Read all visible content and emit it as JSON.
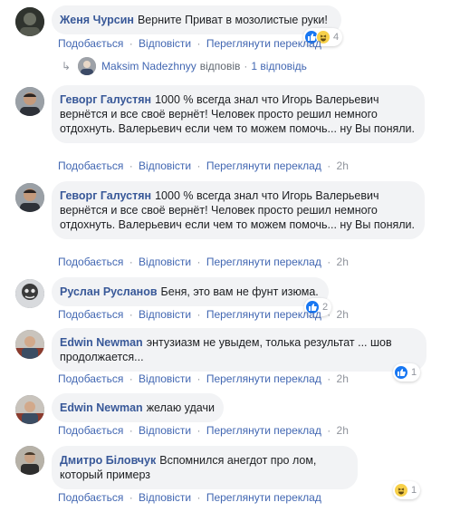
{
  "actions": {
    "like": "Подобається",
    "reply": "Відповісти",
    "translate": "Переглянути переклад",
    "sep": "·"
  },
  "comments": [
    {
      "author": "Женя Чурсин",
      "text": "Верните Приват в мозолистые руки!",
      "time": "",
      "reactions": {
        "types": [
          "like",
          "haha"
        ],
        "count": "4"
      },
      "replies": {
        "author": "Maksim Nadezhnyy",
        "verb": "відповів",
        "sep": "·",
        "count": "1 відповідь"
      }
    },
    {
      "author": "Геворг Галустян",
      "text": "1000 % всегда знал что Игорь Валерьевич вернётся и все своё вернёт! Человек просто решил немного отдохнуть. Валерьевич если чем то можем помочь... ну Вы поняли.",
      "time": "2h"
    },
    {
      "author": "Геворг Галустян",
      "text": "1000 % всегда знал что Игорь Валерьевич вернётся и все своё вернёт! Человек просто решил немного отдохнуть. Валерьевич если чем то можем помочь... ну Вы поняли.",
      "time": "2h"
    },
    {
      "author": "Руслан Русланов",
      "text": "Беня, это вам не фунт изюма.",
      "time": "2h",
      "reactions": {
        "types": [
          "like"
        ],
        "count": "2"
      }
    },
    {
      "author": "Edwin Newman",
      "text": "энтузиазм не увыдем, толька результат ... шов продолжается...",
      "time": "2h",
      "reactions": {
        "types": [
          "like"
        ],
        "count": "1"
      }
    },
    {
      "author": "Edwin Newman",
      "text": "желаю удачи",
      "time": "2h"
    },
    {
      "author": "Дмитро Біловчук",
      "text": "Вспомнился анегдот про лом, который примерз",
      "time": "",
      "reactions": {
        "types": [
          "haha"
        ],
        "count": "1"
      }
    }
  ]
}
